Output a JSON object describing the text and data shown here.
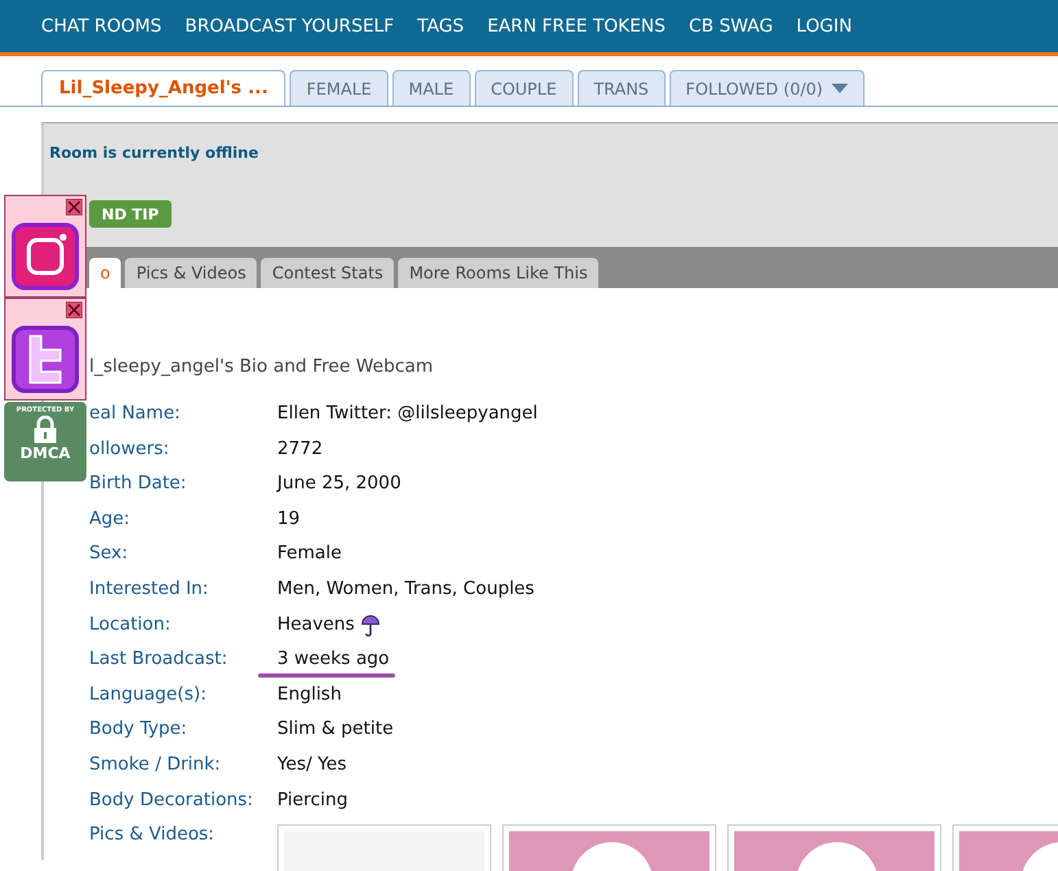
{
  "nav": [
    "CHAT ROOMS",
    "BROADCAST YOURSELF",
    "TAGS",
    "EARN FREE TOKENS",
    "CB SWAG",
    "LOGIN"
  ],
  "tabs": [
    {
      "label": "Lil_Sleepy_Angel's ...",
      "selected": true,
      "dropdown": false
    },
    {
      "label": "FEMALE",
      "selected": false,
      "dropdown": false
    },
    {
      "label": "MALE",
      "selected": false,
      "dropdown": false
    },
    {
      "label": "COUPLE",
      "selected": false,
      "dropdown": false
    },
    {
      "label": "TRANS",
      "selected": false,
      "dropdown": false
    },
    {
      "label": "FOLLOWED (0/0)",
      "selected": false,
      "dropdown": true
    }
  ],
  "room": {
    "status": "Room is currently offline",
    "tip_button": "ND TIP"
  },
  "sub_tabs": [
    {
      "label": "o",
      "selected": true
    },
    {
      "label": "Pics & Videos",
      "selected": false
    },
    {
      "label": "Contest Stats",
      "selected": false
    },
    {
      "label": "More Rooms Like This",
      "selected": false
    }
  ],
  "bio": {
    "heading": "l_sleepy_angel's Bio and Free Webcam",
    "rows": [
      {
        "label": "eal Name:",
        "value": "Ellen Twitter: @lilsleepyangel"
      },
      {
        "label": "ollowers:",
        "value": "2772"
      },
      {
        "label": "Birth Date:",
        "value": "June 25, 2000"
      },
      {
        "label": "Age:",
        "value": "19"
      },
      {
        "label": "Sex:",
        "value": "Female"
      },
      {
        "label": "Interested In:",
        "value": "Men, Women, Trans, Couples"
      },
      {
        "label": "Location:",
        "value": "Heavens",
        "kind": "umbrella"
      },
      {
        "label": "Last Broadcast:",
        "value": "3 weeks ago",
        "underlined": true
      },
      {
        "label": "Language(s):",
        "value": "English"
      },
      {
        "label": "Body Type:",
        "value": "Slim & petite"
      },
      {
        "label": "Smoke / Drink:",
        "value": "Yes/ Yes"
      },
      {
        "label": "Body Decorations:",
        "value": "Piercing"
      }
    ],
    "pics_label": "Pics & Videos:",
    "thumbnails": [
      {
        "kind": "chat"
      },
      {
        "kind": "avatar"
      },
      {
        "kind": "avatar"
      },
      {
        "kind": "avatar"
      }
    ]
  },
  "widgets": [
    {
      "kind": "instagram"
    },
    {
      "kind": "twitter"
    }
  ],
  "badge": {
    "top": "PROTECTED BY",
    "bottom": "DMCA"
  }
}
